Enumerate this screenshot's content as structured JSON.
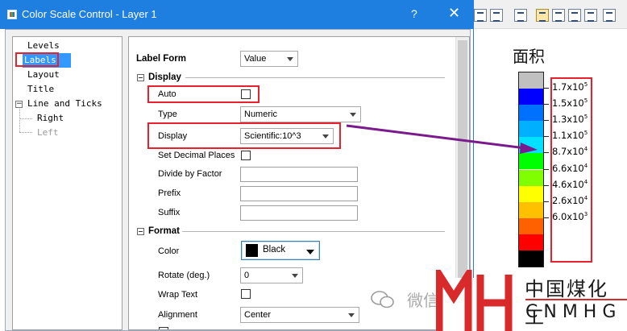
{
  "dialog": {
    "title": "Color Scale Control - Layer 1",
    "help_label": "?",
    "close_label": "✕"
  },
  "tree": {
    "levels": "Levels",
    "labels": "Labels",
    "layout": "Layout",
    "title": "Title",
    "line_and_ticks": "Line and Ticks",
    "right": "Right",
    "left": "Left"
  },
  "panel": {
    "label_form": {
      "label": "Label Form",
      "value": "Value"
    },
    "display_section": "Display",
    "auto": {
      "label": "Auto",
      "checked": false
    },
    "type": {
      "label": "Type",
      "value": "Numeric"
    },
    "display": {
      "label": "Display",
      "value": "Scientific:10^3"
    },
    "set_decimal_places": {
      "label": "Set Decimal Places",
      "checked": false
    },
    "divide_by_factor": {
      "label": "Divide by Factor",
      "value": ""
    },
    "prefix": {
      "label": "Prefix",
      "value": ""
    },
    "suffix": {
      "label": "Suffix",
      "value": ""
    },
    "format_section": "Format",
    "color": {
      "label": "Color",
      "value": "Black",
      "swatch": "#000000"
    },
    "rotate": {
      "label": "Rotate (deg.)",
      "value": "0"
    },
    "wrap_text": {
      "label": "Wrap Text",
      "checked": false
    },
    "alignment": {
      "label": "Alignment",
      "value": "Center"
    }
  },
  "color_scale": {
    "title": "面积",
    "segment_colors": [
      "#c0c0c0",
      "#0000ff",
      "#0070ff",
      "#00b0ff",
      "#00e0ff",
      "#00ff00",
      "#80ff00",
      "#ffff00",
      "#ffc000",
      "#ff6000",
      "#ff0000",
      "#000000"
    ],
    "labels": [
      {
        "mantissa": "1.7x10",
        "exp": "5"
      },
      {
        "mantissa": "1.5x10",
        "exp": "5"
      },
      {
        "mantissa": "1.3x10",
        "exp": "5"
      },
      {
        "mantissa": "1.1x10",
        "exp": "5"
      },
      {
        "mantissa": "8.7x10",
        "exp": "4"
      },
      {
        "mantissa": "6.6x10",
        "exp": "4"
      },
      {
        "mantissa": "4.6x10",
        "exp": "4"
      },
      {
        "mantissa": "2.6x10",
        "exp": "4"
      },
      {
        "mantissa": "6.0x10",
        "exp": "3"
      }
    ]
  },
  "watermark": {
    "wechat_text": "微信",
    "logo_cn": "中国煤化工",
    "logo_en": "CNMHG"
  },
  "colors": {
    "title_bar": "#1f7fe0",
    "selection": "#3399ff",
    "highlight_box": "#e8212d",
    "arrow": "#7a1a8c"
  }
}
